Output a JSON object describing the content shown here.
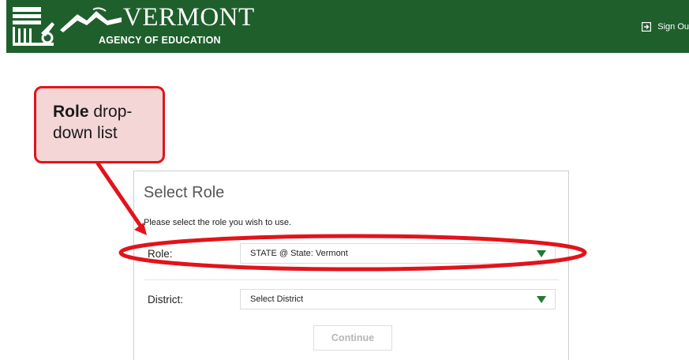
{
  "header": {
    "brand_title": "VERMONT",
    "brand_subtitle": "AGENCY OF EDUCATION",
    "sign_out_label": "Sign Ou"
  },
  "callout": {
    "bold": "Role",
    "line1_rest": " drop-",
    "line2": "down list"
  },
  "panel": {
    "title": "Select Role",
    "subtitle": "Please select the role you wish to use.",
    "role": {
      "label": "Role:",
      "value": "STATE @ State: Vermont"
    },
    "district": {
      "label": "District:",
      "value": "Select District"
    },
    "continue_label": "Continue"
  },
  "colors": {
    "header_bg": "#1f5f2c",
    "callout_border": "#e2131b",
    "callout_fill": "#f4d6d7",
    "caret": "#1f7a34"
  },
  "icons": {
    "logo": "vermont-building-icon",
    "mountain": "mountain-logo-icon",
    "sign_out": "sign-out-icon",
    "dropdown": "caret-down-icon"
  }
}
